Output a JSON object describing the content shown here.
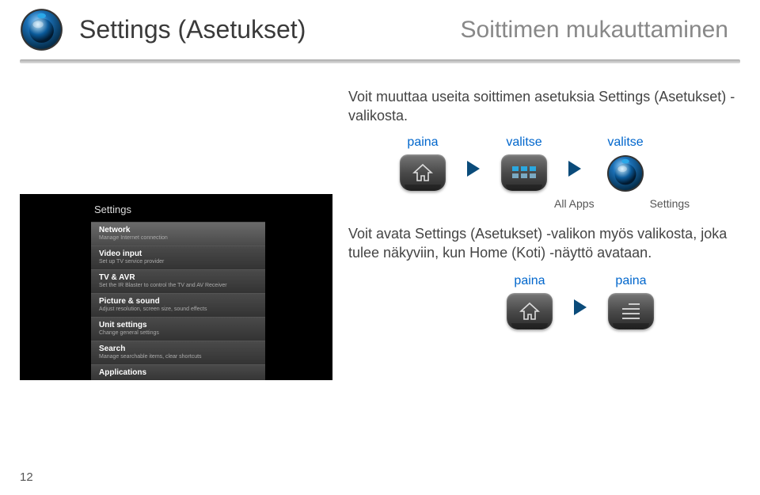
{
  "header": {
    "title": "Settings (Asetukset)",
    "subtitle": "Soittimen mukauttaminen"
  },
  "intro": "Voit muuttaa useita soittimen asetuksia Settings (Asetukset) -valikosta.",
  "steps1": {
    "press_label": "paina",
    "select_label_1": "valitse",
    "select_label_2": "valitse"
  },
  "under": {
    "all_apps": "All Apps",
    "settings": "Settings"
  },
  "para2": "Voit avata Settings (Asetukset) -valikon myös valikosta, joka tulee näkyviin, kun Home (Koti) -näyttö avataan.",
  "steps2": {
    "press_label_1": "paina",
    "press_label_2": "paina"
  },
  "screenshot": {
    "title": "Settings",
    "items": [
      {
        "title": "Network",
        "sub": "Manage Internet connection"
      },
      {
        "title": "Video input",
        "sub": "Set up TV service provider"
      },
      {
        "title": "TV & AVR",
        "sub": "Set the IR Blaster to control the TV and AV Receiver"
      },
      {
        "title": "Picture & sound",
        "sub": "Adjust resolution, screen size, sound effects"
      },
      {
        "title": "Unit settings",
        "sub": "Change general settings"
      },
      {
        "title": "Search",
        "sub": "Manage searchable items, clear shortcuts"
      },
      {
        "title": "Applications",
        "sub": ""
      }
    ]
  },
  "page_number": "12"
}
